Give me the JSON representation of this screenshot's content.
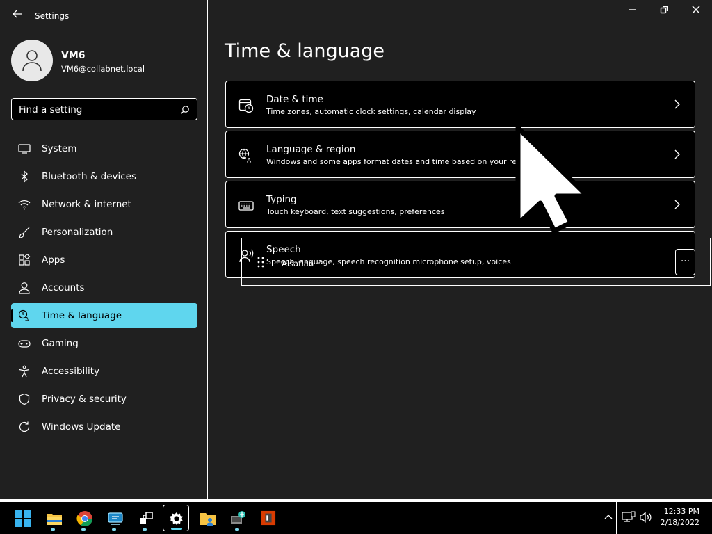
{
  "window": {
    "title": "Settings"
  },
  "user": {
    "name": "VM6",
    "email": "VM6@collabnet.local"
  },
  "search": {
    "placeholder": "Find a setting"
  },
  "nav": {
    "items": [
      {
        "label": "System",
        "icon": "monitor-icon"
      },
      {
        "label": "Bluetooth & devices",
        "icon": "bluetooth-icon"
      },
      {
        "label": "Network & internet",
        "icon": "wifi-icon"
      },
      {
        "label": "Personalization",
        "icon": "brush-icon"
      },
      {
        "label": "Apps",
        "icon": "apps-icon"
      },
      {
        "label": "Accounts",
        "icon": "person-icon"
      },
      {
        "label": "Time & language",
        "icon": "time-language-icon",
        "active": true
      },
      {
        "label": "Gaming",
        "icon": "gamepad-icon"
      },
      {
        "label": "Accessibility",
        "icon": "accessibility-icon"
      },
      {
        "label": "Privacy & security",
        "icon": "shield-icon"
      },
      {
        "label": "Windows Update",
        "icon": "update-icon"
      }
    ]
  },
  "main": {
    "title": "Time & language",
    "cards": [
      {
        "title": "Date & time",
        "subtitle": "Time zones, automatic clock settings, calendar display",
        "icon": "clock-calendar-icon"
      },
      {
        "title": "Language & region",
        "subtitle": "Windows and some apps format dates and time based on your reg",
        "icon": "language-icon"
      },
      {
        "title": "Typing",
        "subtitle": "Touch keyboard, text suggestions, preferences",
        "icon": "keyboard-icon"
      },
      {
        "title": "Speech",
        "subtitle": "Speech language, speech recognition microphone setup, voices",
        "icon": "speech-icon"
      }
    ],
    "drag_ghost": {
      "label": "Alsatian",
      "more": "···"
    }
  },
  "taskbar": {
    "apps": [
      "start-icon",
      "file-explorer-icon",
      "chrome-icon",
      "remote-app-icon",
      "network-tool-icon",
      "settings-icon",
      "folder-user-icon",
      "network-share-icon",
      "office-icon"
    ],
    "active_app": "settings-icon",
    "clock": {
      "time": "12:33 PM",
      "date": "2/18/2022"
    }
  },
  "colors": {
    "accent": "#5fd6ee",
    "background": "#202020",
    "card": "#000000"
  }
}
